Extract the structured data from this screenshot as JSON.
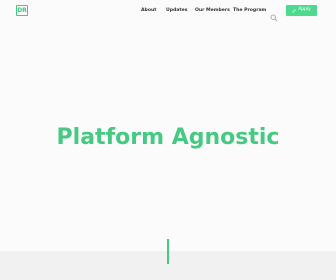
{
  "header": {
    "logo_text": "DR",
    "nav": {
      "about": "About",
      "updates": "Updates",
      "members": "Our Members",
      "program": "The Program"
    },
    "search_icon": "search-icon",
    "cta_label": "Apply",
    "cta_icon": "pencil-icon"
  },
  "hero": {
    "title": "Platform Agnostic"
  },
  "colors": {
    "accent": "#46c983",
    "button": "#4fd98f",
    "nav_text": "#333333",
    "background": "#fbfbfb"
  }
}
